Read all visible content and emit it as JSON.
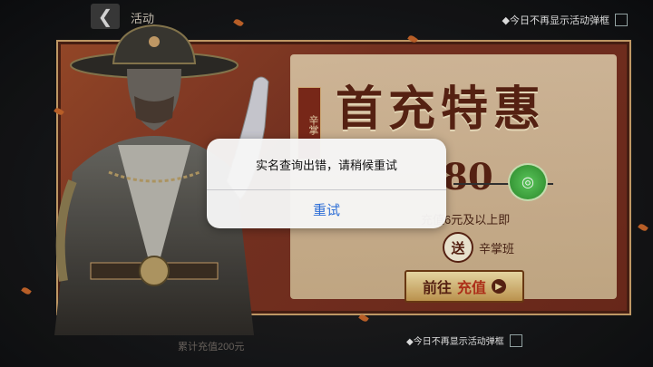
{
  "topbar": {
    "back_icon": "chevron-left-icon",
    "title": "活动",
    "hide_popup_label": "◆今日不再显示活动弹框"
  },
  "banner": {
    "headline": "首充特惠",
    "vertical_tag": "辛掌",
    "price": "80",
    "recharge_desc": "充值6元及以上即",
    "gift_badge": "送",
    "gift_name": "辛掌班",
    "go_button_prefix": "前往",
    "go_button_accent": "充值",
    "go_button_arrow": "▶"
  },
  "bottom": {
    "hide_popup_label": "◆今日不再显示活动弹框",
    "faded_text": "累计充值200元"
  },
  "dialog": {
    "message": "实名查询出错，请稍候重试",
    "retry_label": "重试"
  },
  "colors": {
    "banner_red": "#7a3322",
    "ios_blue": "#2f6fd6",
    "gold": "#c9a06a"
  }
}
